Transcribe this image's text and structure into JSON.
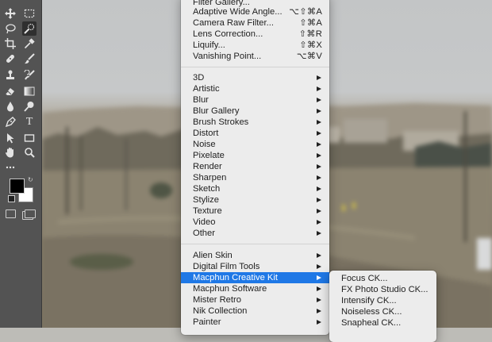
{
  "filter_menu": {
    "items_top": [
      {
        "label": "Filter Gallery...",
        "shortcut": ""
      },
      {
        "label": "Adaptive Wide Angle...",
        "shortcut": "⌥⇧⌘A"
      },
      {
        "label": "Camera Raw Filter...",
        "shortcut": "⇧⌘A"
      },
      {
        "label": "Lens Correction...",
        "shortcut": "⇧⌘R"
      },
      {
        "label": "Liquify...",
        "shortcut": "⇧⌘X"
      },
      {
        "label": "Vanishing Point...",
        "shortcut": "⌥⌘V"
      }
    ],
    "items_builtin": [
      "3D",
      "Artistic",
      "Blur",
      "Blur Gallery",
      "Brush Strokes",
      "Distort",
      "Noise",
      "Pixelate",
      "Render",
      "Sharpen",
      "Sketch",
      "Stylize",
      "Texture",
      "Video",
      "Other"
    ],
    "items_plugins": [
      "Alien Skin",
      "Digital Film Tools",
      "Macphun Creative Kit",
      "Macphun Software",
      "Mister Retro",
      "Nik Collection",
      "Painter"
    ],
    "highlighted": "Macphun Creative Kit"
  },
  "submenu": {
    "items": [
      "Focus CK...",
      "FX Photo Studio CK...",
      "Intensify CK...",
      "Noiseless CK...",
      "Snapheal CK..."
    ]
  },
  "toolbar": {
    "tools": [
      {
        "name": "move-tool-icon"
      },
      {
        "name": "marquee-tool-icon"
      },
      {
        "name": "lasso-tool-icon"
      },
      {
        "name": "quick-selection-tool-icon"
      },
      {
        "name": "crop-tool-icon"
      },
      {
        "name": "eyedropper-tool-icon"
      },
      {
        "name": "healing-brush-tool-icon"
      },
      {
        "name": "brush-tool-icon"
      },
      {
        "name": "clone-stamp-tool-icon"
      },
      {
        "name": "history-brush-tool-icon"
      },
      {
        "name": "eraser-tool-icon"
      },
      {
        "name": "gradient-tool-icon"
      },
      {
        "name": "blur-tool-icon"
      },
      {
        "name": "dodge-tool-icon"
      },
      {
        "name": "pen-tool-icon"
      },
      {
        "name": "type-tool-icon"
      },
      {
        "name": "path-selection-tool-icon"
      },
      {
        "name": "rectangle-tool-icon"
      },
      {
        "name": "hand-tool-icon"
      },
      {
        "name": "zoom-tool-icon"
      },
      {
        "name": "more-tools-icon"
      }
    ],
    "type_glyph": "T",
    "foreground_color": "#000000",
    "background_color": "#ffffff"
  },
  "colors": {
    "menu_bg": "#ececec",
    "highlight": "#1f78e6",
    "toolbar_bg": "#535353"
  }
}
